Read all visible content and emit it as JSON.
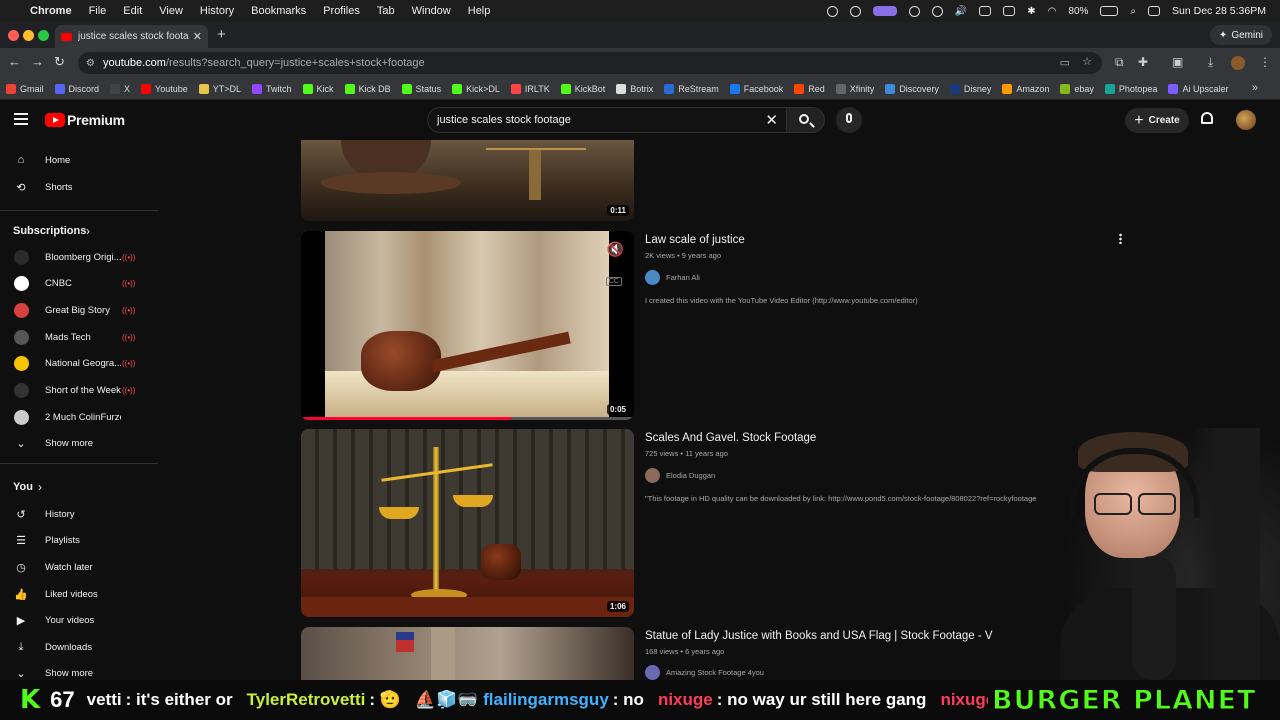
{
  "menubar": {
    "app": "Chrome",
    "items": [
      "File",
      "Edit",
      "View",
      "History",
      "Bookmarks",
      "Profiles",
      "Tab",
      "Window",
      "Help"
    ],
    "battery": "80%",
    "datetime": "Sun Dec 28  5:36PM"
  },
  "browser": {
    "tab_title": "justice scales stock footage -",
    "gemini_label": "Gemini",
    "url_host": "youtube.com",
    "url_path": "/results?search_query=justice+scales+stock+footage"
  },
  "bookmarks": [
    {
      "label": "Gmail",
      "color": "#ea4335"
    },
    {
      "label": "Discord",
      "color": "#5865f2"
    },
    {
      "label": "X",
      "color": "#444444"
    },
    {
      "label": "Youtube",
      "color": "#ff0000"
    },
    {
      "label": "YT>DL",
      "color": "#e8c44a"
    },
    {
      "label": "Twitch",
      "color": "#9146ff"
    },
    {
      "label": "Kick",
      "color": "#53fc18"
    },
    {
      "label": "Kick DB",
      "color": "#53fc18"
    },
    {
      "label": "Status",
      "color": "#53fc18"
    },
    {
      "label": "Kick>DL",
      "color": "#53fc18"
    },
    {
      "label": "IRLTK",
      "color": "#ff4444"
    },
    {
      "label": "KickBot",
      "color": "#53fc18"
    },
    {
      "label": "Botrix",
      "color": "#dddddd"
    },
    {
      "label": "ReStream",
      "color": "#2b6cd4"
    },
    {
      "label": "Facebook",
      "color": "#1877f2"
    },
    {
      "label": "Red",
      "color": "#ff4500"
    },
    {
      "label": "Xfinity",
      "color": "#666666"
    },
    {
      "label": "Discovery",
      "color": "#3f8ad6"
    },
    {
      "label": "Disney",
      "color": "#1a3a7a"
    },
    {
      "label": "Amazon",
      "color": "#ff9900"
    },
    {
      "label": "ebay",
      "color": "#86b817"
    },
    {
      "label": "Photopea",
      "color": "#18a497"
    },
    {
      "label": "Ai Upscaler",
      "color": "#7b5cff"
    }
  ],
  "youtube": {
    "brand": "Premium",
    "search_value": "justice scales stock footage",
    "create_label": "Create"
  },
  "sidebar": {
    "main": [
      {
        "label": "Home",
        "icon": "home-icon"
      },
      {
        "label": "Shorts",
        "icon": "shorts-icon"
      }
    ],
    "subscriptions_heading": "Subscriptions",
    "subscriptions": [
      {
        "label": "Bloomberg Origi...",
        "color": "#2b2b2b",
        "live": true
      },
      {
        "label": "CNBC",
        "color": "#ffffff",
        "live": true
      },
      {
        "label": "Great Big Story",
        "color": "#d94040",
        "live": true
      },
      {
        "label": "Mads Tech",
        "color": "#555555",
        "live": true
      },
      {
        "label": "National Geogra...",
        "color": "#f6c500",
        "live": true
      },
      {
        "label": "Short of the Week",
        "color": "#333333",
        "live": true
      },
      {
        "label": "2 Much ColinFurze",
        "color": "#cccccc",
        "live": false
      }
    ],
    "subs_show_more": "Show more",
    "you_heading": "You",
    "you_items": [
      {
        "label": "History",
        "icon": "history-icon"
      },
      {
        "label": "Playlists",
        "icon": "playlists-icon"
      },
      {
        "label": "Watch later",
        "icon": "watch-later-icon"
      },
      {
        "label": "Liked videos",
        "icon": "like-icon"
      },
      {
        "label": "Your videos",
        "icon": "your-videos-icon"
      },
      {
        "label": "Downloads",
        "icon": "download-icon"
      }
    ],
    "you_show_more": "Show more"
  },
  "results": [
    {
      "title": "",
      "duration": "0:11"
    },
    {
      "title": "Law scale of justice",
      "meta": "2K views • 9 years ago",
      "channel": "Farhan Ali",
      "description": "I created this video with the YouTube Video Editor (http://www.youtube.com/editor)",
      "duration": "0:05"
    },
    {
      "title": "Scales And Gavel. Stock Footage",
      "meta": "725 views • 11 years ago",
      "channel": "Elodia Duggan",
      "description": "\"This footage in HD quality can be downloaded by link: http://www.pond5.com/stock-footage/808022?ref=rockyfootage",
      "duration": "1:06"
    },
    {
      "title": "Statue of Lady Justice with Books and USA Flag | Stock Footage - V",
      "meta": "168 views • 6 years ago",
      "channel": "Amazing Stock Footage 4you"
    }
  ],
  "ticker": {
    "viewers": "67",
    "messages": [
      {
        "user": "vetti",
        "text": ": it's either or",
        "color": "#ffffff"
      },
      {
        "user": "TylerRetrovetti",
        "text": ": 🫡",
        "color": "#c6f03a"
      },
      {
        "user": "⛵🧊🥽 flailingarmsguy",
        "text": ": no",
        "color": "#3fb3ff"
      },
      {
        "user": "nixuge",
        "text": ": no way ur still here gang",
        "color": "#ff3b5c"
      },
      {
        "user": "nixuge",
        "text": ": 🐸",
        "color": "#ff3b5c"
      }
    ],
    "banner": "BURGER PLANET"
  }
}
